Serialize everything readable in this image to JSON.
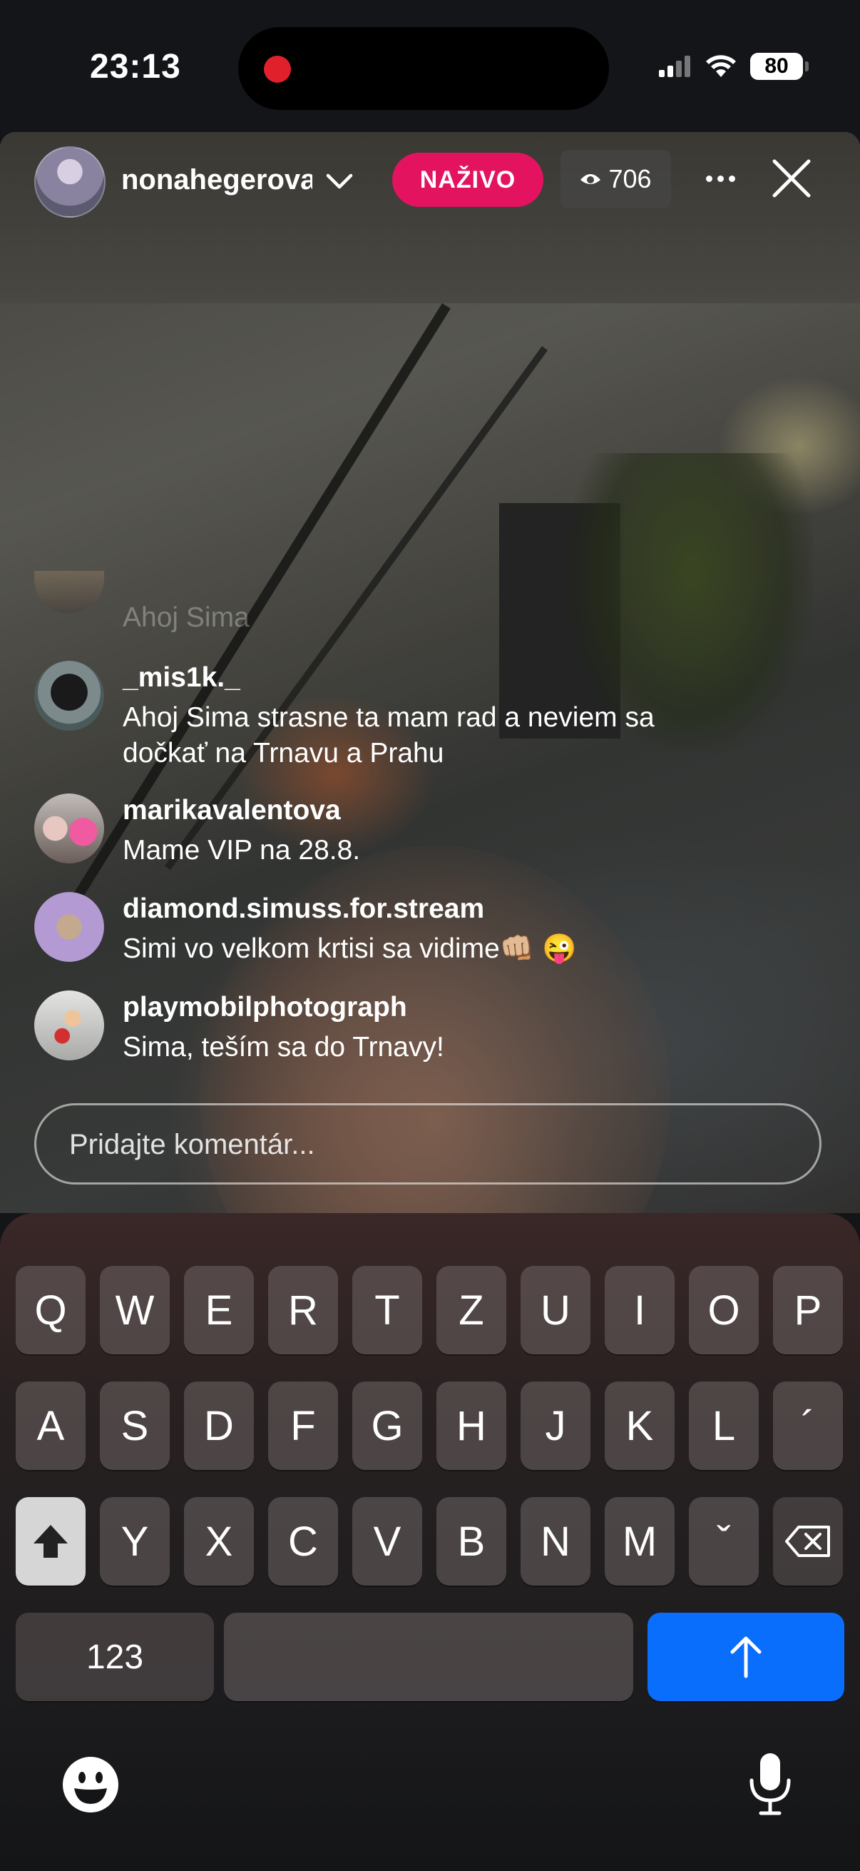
{
  "status_bar": {
    "time": "23:13",
    "battery": "80"
  },
  "live": {
    "host_username": "nonahegerova",
    "badge": "NAŽIVO",
    "viewer_count": "706"
  },
  "comments": [
    {
      "username": "",
      "text": "Ahoj Sima",
      "faded": true
    },
    {
      "username": "_mis1k._",
      "text_line1": "Ahoj Sima strasne ta mam rad a neviem sa",
      "text_line2": "dočkať na Trnavu a Prahu"
    },
    {
      "username": "marikavalentova",
      "text": "Mame VIP na 28.8."
    },
    {
      "username": "diamond.simuss.for.stream",
      "text": "Simi vo velkom krtisi sa vidime👊🏼 😜"
    },
    {
      "username": "playmobilphotograph",
      "text": "Sima, teším sa do Trnavy!"
    }
  ],
  "comment_box": {
    "placeholder": "Pridajte komentár..."
  },
  "keyboard": {
    "row1": [
      "Q",
      "W",
      "E",
      "R",
      "T",
      "Z",
      "U",
      "I",
      "O",
      "P"
    ],
    "row2": [
      "A",
      "S",
      "D",
      "F",
      "G",
      "H",
      "J",
      "K",
      "L",
      "´"
    ],
    "row3": [
      "Y",
      "X",
      "C",
      "V",
      "B",
      "N",
      "M",
      "ˇ"
    ],
    "numbers_key": "123"
  }
}
